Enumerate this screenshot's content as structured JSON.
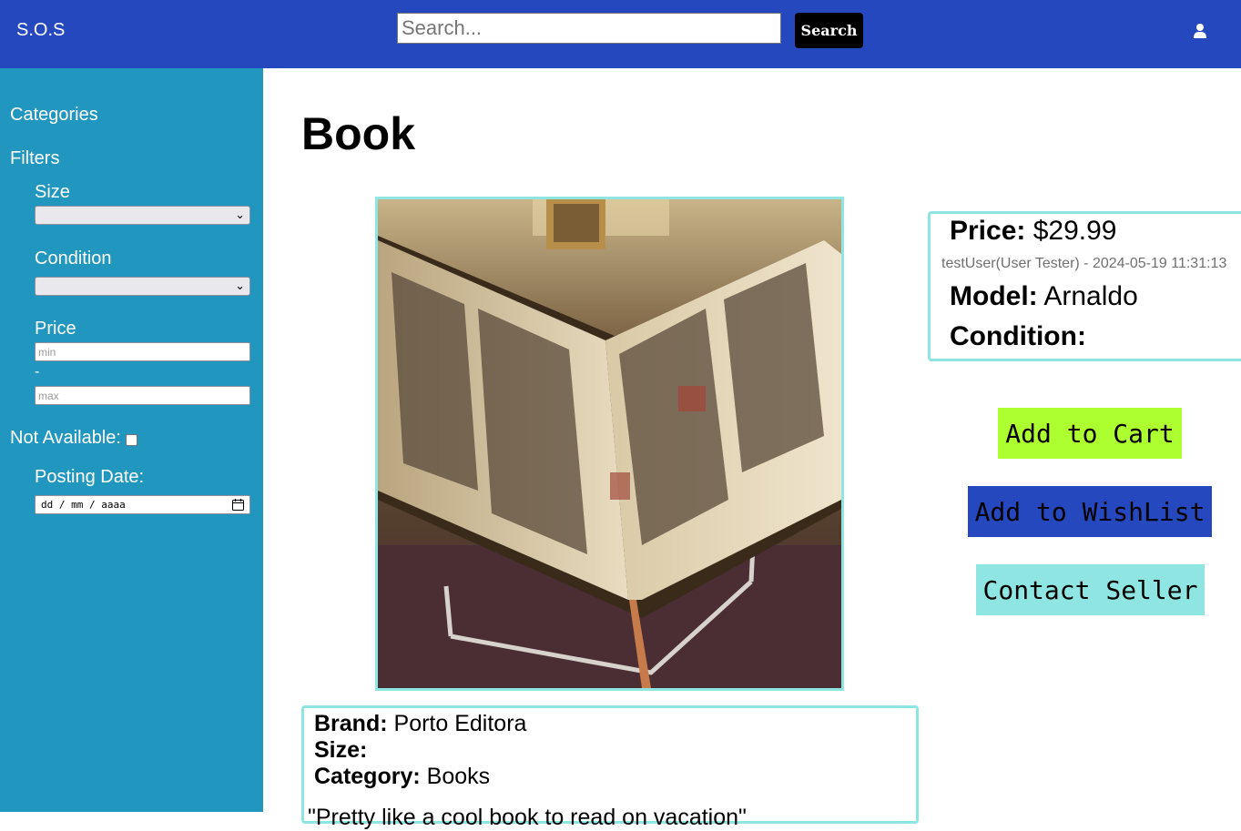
{
  "header": {
    "brand": "S.O.S",
    "search_placeholder": "Search...",
    "search_button": "Search",
    "user_icon": "user-icon"
  },
  "sidebar": {
    "categories_label": "Categories",
    "filters_label": "Filters",
    "size_label": "Size",
    "size_value": "",
    "condition_label": "Condition",
    "condition_value": "",
    "price_label": "Price",
    "price_min_placeholder": "min",
    "price_separator": "-",
    "price_max_placeholder": "max",
    "not_available_label": "Not Available:",
    "not_available_checked": false,
    "posting_date_label": "Posting Date:",
    "posting_date_placeholder": "dd / mm / aaaa"
  },
  "product": {
    "title": "Book",
    "image_alt": "Open antique book on a stand",
    "price_label": "Price:",
    "price_value": "$29.99",
    "seller_line": "testUser(User Tester) - 2024-05-19 11:31:13",
    "model_label": "Model:",
    "model_value": "Arnaldo",
    "condition_label": "Condition:",
    "condition_value": "",
    "brand_label": "Brand:",
    "brand_value": "Porto Editora",
    "size_label": "Size:",
    "size_value": "",
    "category_label": "Category:",
    "category_value": "Books",
    "description": "\"Pretty like a cool book to read on vacation\""
  },
  "actions": {
    "add_to_cart": "Add to Cart",
    "add_to_wishlist": "Add to WishList",
    "contact_seller": "Contact Seller"
  },
  "colors": {
    "header_bg": "#2548be",
    "sidebar_bg": "#2196bf",
    "accent_border": "#8ee5e1",
    "cart_bg": "#adff2f",
    "wishlist_bg": "#2548be",
    "contact_bg": "#8ee5e1"
  }
}
